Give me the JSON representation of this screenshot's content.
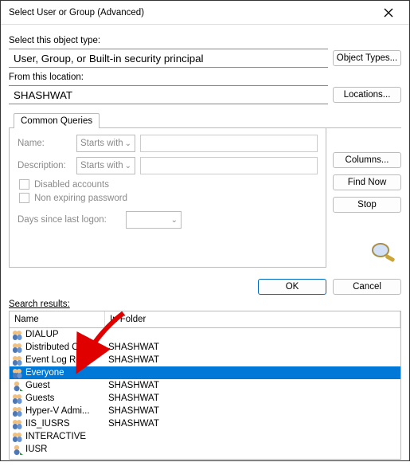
{
  "titlebar": {
    "title": "Select User or Group (Advanced)"
  },
  "objtype": {
    "label": "Select this object type:",
    "value": "User, Group, or Built-in security principal",
    "button": "Object Types..."
  },
  "location": {
    "label": "From this location:",
    "value": "SHASHWAT",
    "button": "Locations..."
  },
  "tab": {
    "label": "Common Queries"
  },
  "queries": {
    "name_label": "Name:",
    "name_combo": "Starts with",
    "desc_label": "Description:",
    "desc_combo": "Starts with",
    "disabled_label": "Disabled accounts",
    "nonexp_label": "Non expiring password",
    "days_label": "Days since last logon:"
  },
  "sidebar": {
    "columns": "Columns...",
    "findnow": "Find Now",
    "stop": "Stop"
  },
  "actions": {
    "ok": "OK",
    "cancel": "Cancel"
  },
  "results": {
    "label": "Search results:",
    "col_name": "Name",
    "col_folder": "In Folder",
    "rows": [
      {
        "iconType": "group",
        "name": "DIALUP",
        "folder": ""
      },
      {
        "iconType": "group",
        "name": "Distributed C...",
        "folder": "SHASHWAT"
      },
      {
        "iconType": "group",
        "name": "Event Log Re...",
        "folder": "SHASHWAT"
      },
      {
        "iconType": "group",
        "name": "Everyone",
        "folder": "",
        "selected": true
      },
      {
        "iconType": "user",
        "name": "Guest",
        "folder": "SHASHWAT"
      },
      {
        "iconType": "group",
        "name": "Guests",
        "folder": "SHASHWAT"
      },
      {
        "iconType": "group",
        "name": "Hyper-V Admi...",
        "folder": "SHASHWAT"
      },
      {
        "iconType": "group",
        "name": "IIS_IUSRS",
        "folder": "SHASHWAT"
      },
      {
        "iconType": "group",
        "name": "INTERACTIVE",
        "folder": ""
      },
      {
        "iconType": "user",
        "name": "IUSR",
        "folder": ""
      }
    ]
  }
}
